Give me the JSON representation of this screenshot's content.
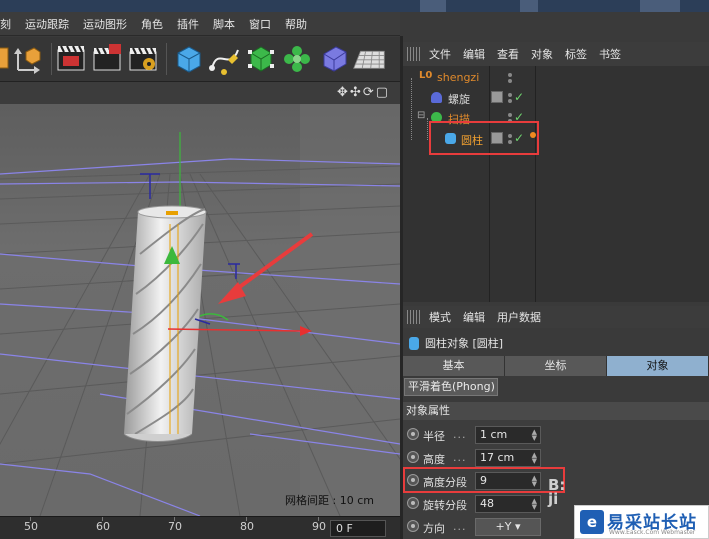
{
  "menubar": {
    "items": [
      "刻",
      "运动跟踪",
      "运动图形",
      "角色",
      "插件",
      "脚本",
      "窗口",
      "帮助"
    ]
  },
  "toolbar": {
    "icons": [
      "axis-icon",
      "cube-primitive-icon",
      "clapper-render-icon",
      "clapper-render-region-icon",
      "clapper-render-settings-icon",
      "cube-add-icon",
      "pen-spline-icon",
      "nurbs-cube-icon",
      "cloner-icon",
      "deformer-icon",
      "floor-plane-icon"
    ]
  },
  "viewport": {
    "nav_icons": "✥✣⟳▢",
    "grid_label": "网格间距 : 10 cm"
  },
  "timeline": {
    "ticks": [
      "50",
      "60",
      "70",
      "80",
      "90"
    ],
    "frame_field": "0 F"
  },
  "object_manager": {
    "menu": [
      "文件",
      "编辑",
      "查看",
      "对象",
      "标签",
      "书签"
    ],
    "objects": [
      {
        "name": "shengzi",
        "color": "#e08a2c",
        "icon": "null-object-icon"
      },
      {
        "name": "螺旋",
        "color": "#d8d8d8",
        "icon": "helix-icon"
      },
      {
        "name": "扫描",
        "color": "#e08a2c",
        "icon": "sweep-icon"
      },
      {
        "name": "圆柱",
        "color": "#f0a030",
        "icon": "cylinder-icon"
      }
    ]
  },
  "attribute_manager": {
    "menu": [
      "模式",
      "编辑",
      "用户数据"
    ],
    "title": "圆柱对象 [圆柱]",
    "tabs": [
      "基本",
      "坐标",
      "对象"
    ],
    "active_tab": "对象",
    "phong_tab": "平滑着色(Phong)",
    "section": "对象属性",
    "props": [
      {
        "label": "半径",
        "dots": "...",
        "value": "1 cm"
      },
      {
        "label": "高度",
        "dots": "...",
        "value": "17 cm"
      },
      {
        "label": "高度分段",
        "dots": "",
        "value": "9"
      },
      {
        "label": "旋转分段",
        "dots": "",
        "value": "48"
      },
      {
        "label": "方向",
        "dots": "...",
        "value": "+Y"
      }
    ]
  },
  "watermark": {
    "logo": "e",
    "text": "易采站长站",
    "sub": "Www.Easck.Com  Webmaster",
    "side_text": "B:\nji"
  },
  "colors": {
    "highlight": "#e83c3c",
    "accent_orange": "#f0a030",
    "tab_active": "#8fb0cf"
  }
}
